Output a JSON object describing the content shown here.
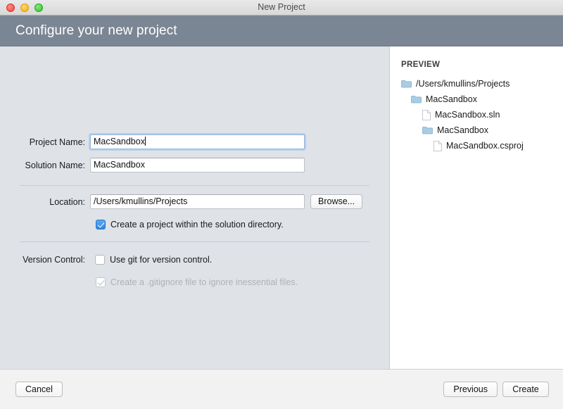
{
  "window": {
    "title": "New Project",
    "traffic_lights": [
      "close-button",
      "minimize-button",
      "maximize-button"
    ]
  },
  "header": {
    "title": "Configure your new project"
  },
  "form": {
    "project_name": {
      "label": "Project Name:",
      "value": "MacSandbox",
      "placeholder": ""
    },
    "solution_name": {
      "label": "Solution Name:",
      "value": "MacSandbox",
      "placeholder": ""
    },
    "location": {
      "label": "Location:",
      "value": "/Users/kmullins/Projects",
      "placeholder": "",
      "browse_label": "Browse..."
    },
    "create_project_in_solution_dir": {
      "label": "Create a project within the solution directory.",
      "checked": true
    },
    "version_control": {
      "label": "Version Control:",
      "use_git": {
        "label": "Use git for version control.",
        "checked": false
      },
      "gitignore": {
        "label": "Create a .gitignore file to ignore inessential files.",
        "checked": true,
        "disabled": true
      }
    }
  },
  "preview": {
    "title": "PREVIEW",
    "tree": [
      {
        "name": "/Users/kmullins/Projects",
        "type": "folder",
        "depth": 0
      },
      {
        "name": "MacSandbox",
        "type": "folder",
        "depth": 1
      },
      {
        "name": "MacSandbox.sln",
        "type": "file",
        "depth": 2
      },
      {
        "name": "MacSandbox",
        "type": "folder",
        "depth": 2
      },
      {
        "name": "MacSandbox.csproj",
        "type": "file",
        "depth": 3
      }
    ]
  },
  "footer": {
    "cancel_label": "Cancel",
    "previous_label": "Previous",
    "create_label": "Create"
  },
  "colors": {
    "header_band": "#7b8694",
    "form_background": "#dfe2e7",
    "preview_background": "#ffffff",
    "footer_background": "#f2f2f2",
    "checkbox_accent": "#2f86e0",
    "folder_icon": "#9cc4e0"
  }
}
